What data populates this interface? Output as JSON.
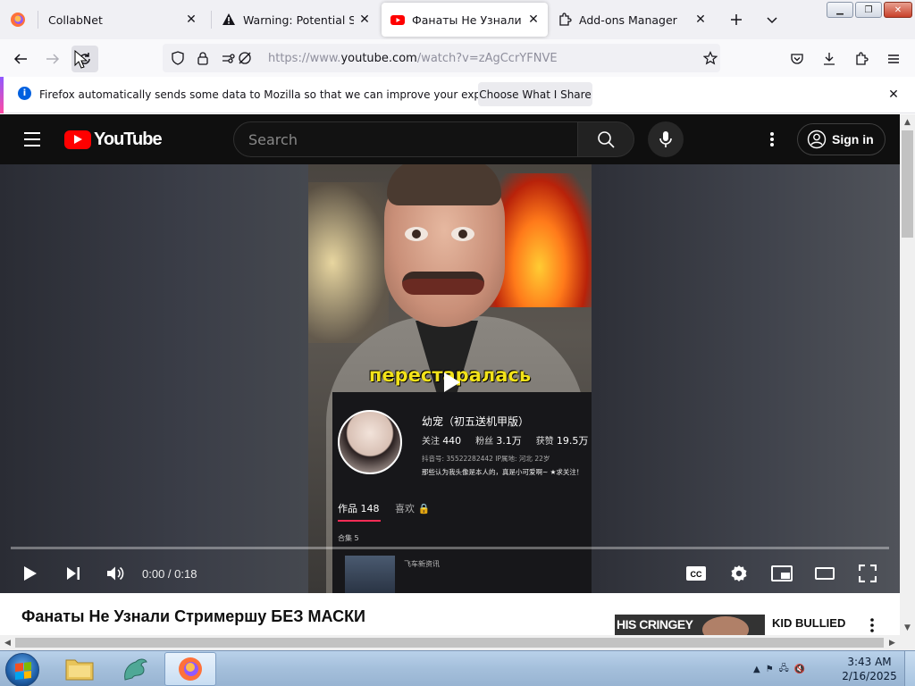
{
  "browser": {
    "tabs": [
      {
        "title": "CollabNet",
        "favicon": "firefox-icon",
        "active": false
      },
      {
        "title": "Warning: Potential Security Risk Ahead",
        "favicon": "warning-icon",
        "active": false
      },
      {
        "title": "Фанаты Не Узнали Стримершу БЕЗ МАСКИ",
        "favicon": "youtube-icon",
        "active": true
      },
      {
        "title": "Add-ons Manager",
        "favicon": "puzzle-icon",
        "active": false
      }
    ],
    "url": {
      "prefix": "https://www.",
      "host": "youtube.com",
      "path": "/watch?v=zAgCcrYFNVE"
    },
    "notification": {
      "text": "Firefox automatically sends some data to Mozilla so that we can improve your experience.",
      "button_label": "Choose What I Share"
    }
  },
  "youtube": {
    "logo_text": "YouTube",
    "search_placeholder": "Search",
    "sign_in_label": "Sign in",
    "player": {
      "current_time": "0:00",
      "duration": "0:18",
      "time_display": "0:00 / 0:18",
      "progress_fraction": 0,
      "cc_label": "CC"
    },
    "video_frame": {
      "caption": "перестаралась",
      "profile_name": "幼宠（初五送机甲版）",
      "stats": [
        {
          "label": "关注",
          "value": "440"
        },
        {
          "label": "粉丝",
          "value": "3.1万"
        },
        {
          "label": "获赞",
          "value": "19.5万"
        }
      ],
      "meta": "抖音号: 35522282442    IP属地: 河北    22岁",
      "bio": "那些认为我头像是本人的，真是小可爱啊~ ★求关注！",
      "tab_works": "作品 148",
      "tab_likes": "喜欢",
      "collection": "合集 5",
      "news": "飞车新资讯"
    },
    "video_title": "Фанаты Не Узнали Стримершу БЕЗ МАСКИ",
    "recommendation": {
      "thumb_text": "HIS CRINGEY",
      "title": "KID BULLIED"
    }
  },
  "taskbar": {
    "clock_time": "3:43 AM",
    "clock_date": "2/16/2025"
  },
  "colors": {
    "youtube_red": "#ff0000",
    "firefox_accent": "#0060df",
    "player_bg": "#0f0f0f"
  }
}
